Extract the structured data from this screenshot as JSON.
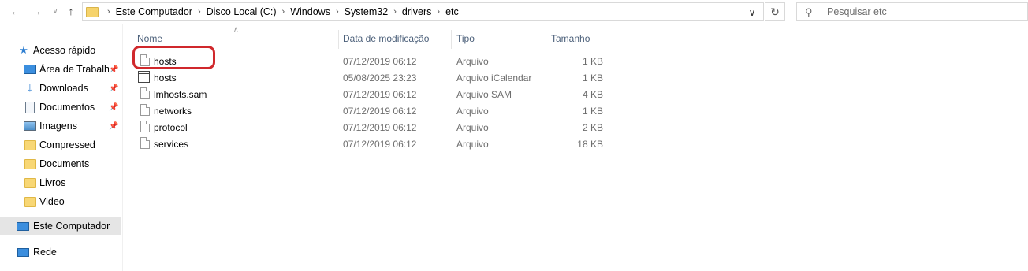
{
  "address": {
    "crumbs": [
      "Este Computador",
      "Disco Local (C:)",
      "Windows",
      "System32",
      "drivers",
      "etc"
    ]
  },
  "search": {
    "placeholder": "Pesquisar etc"
  },
  "sidebar": {
    "quick_access": "Acesso rápido",
    "items": [
      {
        "label": "Área de Trabalho",
        "icon": "desktop-icon",
        "pinned": true
      },
      {
        "label": "Downloads",
        "icon": "download-arrow-icon",
        "pinned": true
      },
      {
        "label": "Documentos",
        "icon": "documents-icon",
        "pinned": true
      },
      {
        "label": "Imagens",
        "icon": "pictures-icon",
        "pinned": true
      },
      {
        "label": "Compressed",
        "icon": "folder-icon",
        "pinned": false
      },
      {
        "label": "Documents",
        "icon": "folder-icon",
        "pinned": false
      },
      {
        "label": "Livros",
        "icon": "folder-icon",
        "pinned": false
      },
      {
        "label": "Video",
        "icon": "folder-icon",
        "pinned": false
      }
    ],
    "this_pc": "Este Computador",
    "network": "Rede"
  },
  "columns": {
    "name": "Nome",
    "date": "Data de modificação",
    "type": "Tipo",
    "size": "Tamanho"
  },
  "files": [
    {
      "name": "hosts",
      "date": "07/12/2019 06:12",
      "type": "Arquivo",
      "size": "1 KB",
      "icon": "file-icon"
    },
    {
      "name": "hosts",
      "date": "05/08/2025 23:23",
      "type": "Arquivo iCalendar",
      "size": "1 KB",
      "icon": "calendar-file-icon"
    },
    {
      "name": "lmhosts.sam",
      "date": "07/12/2019 06:12",
      "type": "Arquivo SAM",
      "size": "4 KB",
      "icon": "file-icon"
    },
    {
      "name": "networks",
      "date": "07/12/2019 06:12",
      "type": "Arquivo",
      "size": "1 KB",
      "icon": "file-icon"
    },
    {
      "name": "protocol",
      "date": "07/12/2019 06:12",
      "type": "Arquivo",
      "size": "2 KB",
      "icon": "file-icon"
    },
    {
      "name": "services",
      "date": "07/12/2019 06:12",
      "type": "Arquivo",
      "size": "18 KB",
      "icon": "file-icon"
    }
  ],
  "colors": {
    "highlight": "#d0282c",
    "selected_nav": "#e5e5e5",
    "header_text": "#4c607a"
  }
}
